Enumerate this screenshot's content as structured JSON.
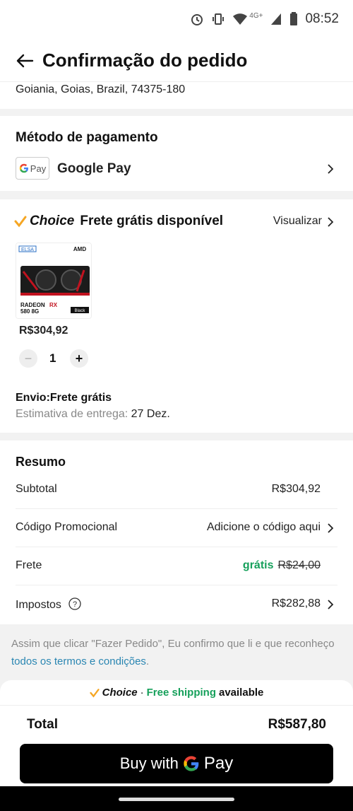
{
  "status_bar": {
    "time": "08:52",
    "network": "4G+"
  },
  "header": {
    "title": "Confirmação do pedido"
  },
  "address": {
    "line": "Goiania, Goias, Brazil, 74375-180"
  },
  "payment": {
    "section_title": "Método de pagamento",
    "badge": "Pay",
    "method": "Google Pay"
  },
  "item": {
    "choice_label": "Choice",
    "free_shipping_label": "Frete grátis disponível",
    "view_label": "Visualizar",
    "product_brand_left": "ELSA",
    "product_brand_right": "AMD",
    "product_text_1": "RADEON",
    "product_text_rx": "RX",
    "product_text_2": "580 8G",
    "product_text_3": "Black",
    "price": "R$304,92",
    "quantity": "1",
    "shipping_label": "Envio:Frete grátis",
    "estimate_label": "Estimativa de entrega:",
    "estimate_date": "27 Dez."
  },
  "summary": {
    "title": "Resumo",
    "subtotal_label": "Subtotal",
    "subtotal_value": "R$304,92",
    "promo_label": "Código Promocional",
    "promo_value": "Adicione o código aqui",
    "freight_label": "Frete",
    "freight_free": "grátis",
    "freight_old": "R$24,00",
    "taxes_label": "Impostos",
    "taxes_value": "R$282,88"
  },
  "terms": {
    "text": "Assim que clicar \"Fazer Pedido\", Eu confirmo que li e que reconheço ",
    "link": "todos os termos e condições",
    "end": "."
  },
  "bottom": {
    "banner_choice": "Choice",
    "banner_dot": "·",
    "banner_free": "Free shipping",
    "banner_available": "available",
    "total_label": "Total",
    "total_value": "R$587,80",
    "buy_label": "Buy with",
    "buy_pay": "Pay"
  },
  "colors": {
    "accent_green": "#16a05b",
    "link_blue": "#2a86b2",
    "choice_orange": "#f5a623"
  }
}
